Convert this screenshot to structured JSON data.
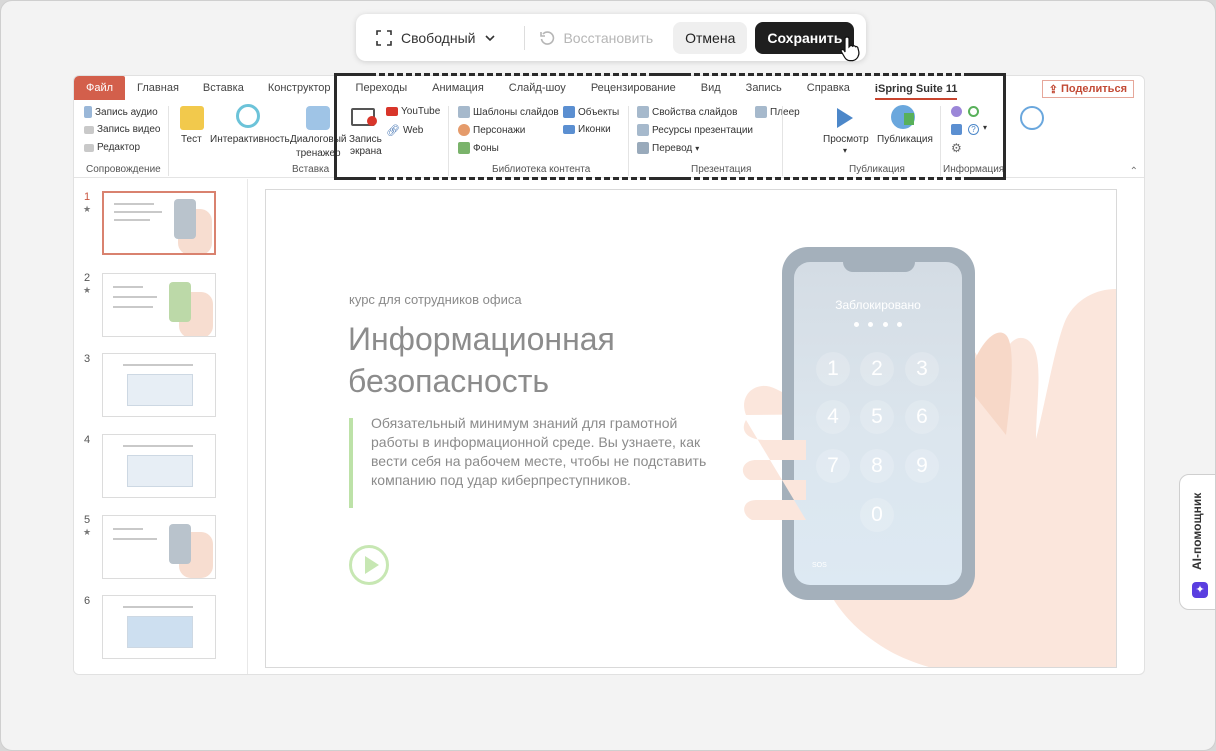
{
  "toolbar": {
    "mode_label": "Свободный",
    "restore_label": "Восстановить",
    "cancel_label": "Отмена",
    "save_label": "Сохранить"
  },
  "tabs": [
    "Файл",
    "Главная",
    "Вставка",
    "Конструктор",
    "Переходы",
    "Анимация",
    "Слайд-шоу",
    "Рецензирование",
    "Вид",
    "Запись",
    "Справка",
    "iSpring Suite 11"
  ],
  "share_label": "Поделиться",
  "ribbon": {
    "audio": "Запись аудио",
    "video": "Запись видео",
    "editor": "Редактор",
    "group_accompany": "Сопровождение",
    "test": "Тест",
    "interactivity": "Интерактивность",
    "dialog": "Диалоговый",
    "dialog2": "тренажер",
    "group_insert": "Вставка",
    "screen_rec": "Запись",
    "screen_rec2": "экрана",
    "youtube": "YouTube",
    "web": "Web",
    "templates": "Шаблоны слайдов",
    "characters": "Персонажи",
    "backgrounds": "Фоны",
    "objects": "Объекты",
    "icons": "Иконки",
    "group_library": "Библиотека контента",
    "slide_props": "Свойства слайдов",
    "resources": "Ресурсы презентации",
    "translate": "Перевод",
    "player": "Плеер",
    "group_presentation": "Презентация",
    "preview": "Просмотр",
    "publish": "Публикация",
    "group_publish": "Публикация",
    "group_info": "Информация"
  },
  "thumbnails": [
    {
      "num": "1",
      "star": "★"
    },
    {
      "num": "2",
      "star": "★"
    },
    {
      "num": "3",
      "star": ""
    },
    {
      "num": "4",
      "star": ""
    },
    {
      "num": "5",
      "star": "★"
    },
    {
      "num": "6",
      "star": ""
    }
  ],
  "slide": {
    "kicker": "курс для сотрудников офиса",
    "title": "Информационная безопасность",
    "description": "Обязательный минимум знаний для грамотной работы в информационной среде. Вы узнаете, как вести себя на рабочем месте, чтобы не подставить компанию под удар киберпреступников.",
    "locked": "Заблокировано",
    "keys": [
      "1",
      "2",
      "3",
      "4",
      "5",
      "6",
      "7",
      "8",
      "9",
      "0"
    ],
    "sos": "SOS"
  },
  "ai_label": "AI-помощник",
  "colors": {
    "accent": "#d35f4b",
    "save_bg": "#1f1f1f",
    "ai": "#5a3ee0"
  }
}
